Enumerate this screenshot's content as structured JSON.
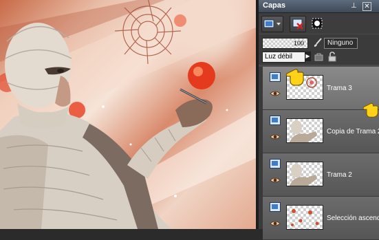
{
  "palette": {
    "title": "Capas",
    "pin_symbol": "⊥",
    "close_symbol": "✕",
    "opacity_value": "100",
    "mask_label": "Ninguno",
    "blend_mode": "Luz débil"
  },
  "layers": [
    {
      "name": "Trama 3",
      "selected": true,
      "thumb": "tile-icon"
    },
    {
      "name": "Copia de Trama 2",
      "selected": false,
      "thumb": "figure"
    },
    {
      "name": "Trama 2",
      "selected": false,
      "thumb": "figure"
    },
    {
      "name": "Selección ascendida",
      "selected": false,
      "thumb": "dots"
    }
  ],
  "colors": {
    "titlebar": "#4e5a68",
    "layer_selected": "#7c7c7c",
    "layer_normal": "#606060",
    "accent_blue": "#3f7cc9"
  },
  "icons": [
    "new-layer-icon",
    "delete-layer-icon",
    "mask-icon",
    "brush-icon",
    "lock-transparency-icon",
    "lock-icon",
    "eye-icon",
    "pointing-hand-cursor"
  ]
}
